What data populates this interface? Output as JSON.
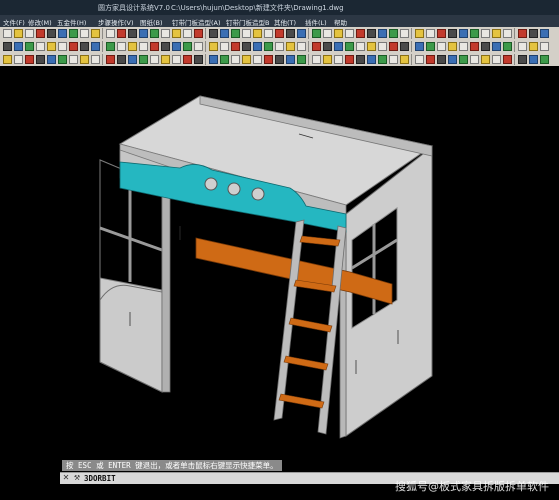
{
  "app": {
    "title": "圆方家具设计系统V7.0",
    "file_path": "C:\\Users\\hujun\\Desktop\\新建文件夹\\Drawing1.dwg"
  },
  "menu": {
    "items": [
      "文件(F)",
      "修改(M)",
      "五金件(H)",
      "步骤操作(V)",
      "图纸(B)",
      "钉带门板造型(A)",
      "钉带门板造型B",
      "其他(T)",
      "插件(L)",
      "帮助"
    ]
  },
  "command": {
    "prompt": "按 ESC 或 ENTER 键退出，或者单击鼠标右键显示快捷菜单。",
    "input_value": "3DORBIT"
  },
  "watermark": "搜狐号@板式家具拆版拆单软件",
  "colors": {
    "viewport_bg": "#000000",
    "panel": "#c8c8c8",
    "rail": "#25b7c1",
    "shelf": "#cf6a15"
  }
}
